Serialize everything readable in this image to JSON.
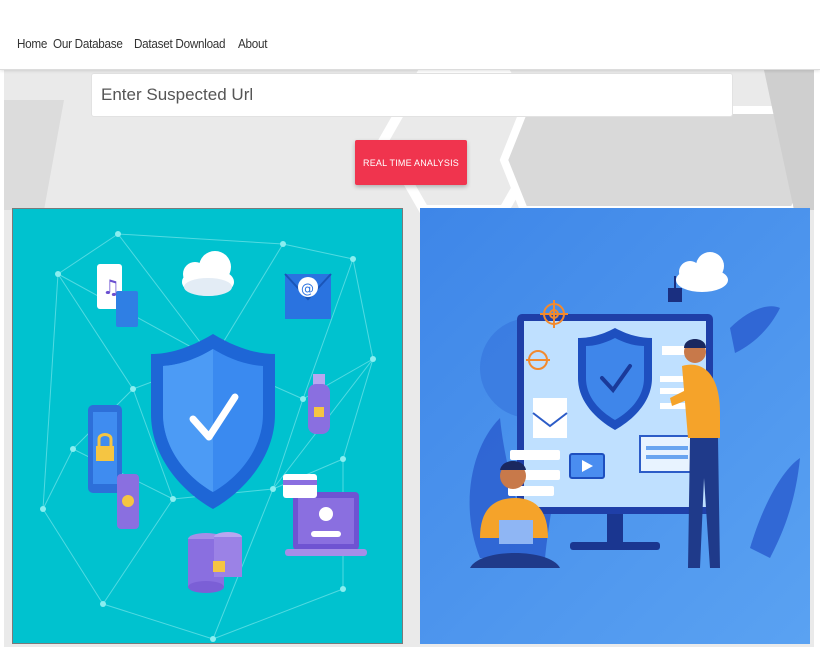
{
  "nav": {
    "items": [
      {
        "label": "Home"
      },
      {
        "label": "Our Database"
      },
      {
        "label": "Dataset Download"
      },
      {
        "label": "About"
      }
    ]
  },
  "search": {
    "placeholder": "Enter Suspected Url",
    "value": ""
  },
  "actions": {
    "analyze_label": "REAL TIME ANALYSIS"
  },
  "illustrations": {
    "left": {
      "icons": [
        "shield-check-icon",
        "cloud-icon",
        "music-file-icon",
        "mail-icon",
        "usb-lock-icon",
        "tablet-lock-icon",
        "phone-lock-icon",
        "database-lock-icon",
        "laptop-login-icon",
        "credit-card-icon"
      ]
    },
    "right": {
      "icons": [
        "monitor-shield-icon",
        "cloud-lock-icon",
        "target-icon",
        "mail-icon",
        "video-icon",
        "person-laptop-icon",
        "person-standing-icon"
      ]
    }
  },
  "colors": {
    "accent": "#f0344e",
    "left_panel_bg": "#00c2cf",
    "right_panel_bg": "#4a93ec"
  }
}
